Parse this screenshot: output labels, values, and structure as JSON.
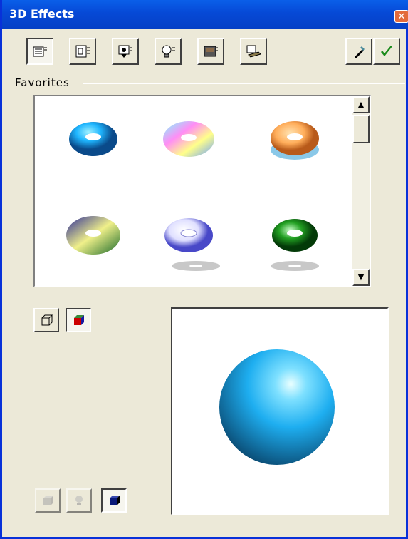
{
  "window": {
    "title": "3D Effects",
    "close_symbol": "✕"
  },
  "toolbar": {
    "tools": [
      {
        "name": "favorites-tool",
        "icon": "favorites-icon"
      },
      {
        "name": "geometry-tool",
        "icon": "geometry-icon"
      },
      {
        "name": "shading-tool",
        "icon": "shading-icon"
      },
      {
        "name": "illumination-tool",
        "icon": "lightbulb-icon"
      },
      {
        "name": "textures-tool",
        "icon": "textures-icon"
      },
      {
        "name": "material-tool",
        "icon": "material-icon"
      }
    ],
    "actions": [
      {
        "name": "pipette-tool",
        "icon": "pipette-icon"
      },
      {
        "name": "assign-button",
        "icon": "checkmark-icon"
      }
    ]
  },
  "favorites": {
    "label": "Favorites",
    "items": [
      {
        "name": "favorite-blue-torus",
        "colors": [
          "#1fb6ff",
          "#0a5fa8"
        ]
      },
      {
        "name": "favorite-rainbow-torus",
        "colors": [
          "#ff7de0",
          "#6ff0ff"
        ]
      },
      {
        "name": "favorite-orange-torus",
        "colors": [
          "#ffc47a",
          "#e87a2a"
        ]
      },
      {
        "name": "favorite-olive-torus",
        "colors": [
          "#8a9a3a",
          "#2b2a8a"
        ]
      },
      {
        "name": "favorite-white-torus",
        "colors": [
          "#ffffff",
          "#5050d0"
        ]
      },
      {
        "name": "favorite-green-torus",
        "colors": [
          "#9aff9a",
          "#0a6a12"
        ]
      }
    ]
  },
  "accent": {
    "sphere_light": "#b8f0ff",
    "sphere_mid": "#1eaef0",
    "sphere_dark": "#0a4a72"
  }
}
